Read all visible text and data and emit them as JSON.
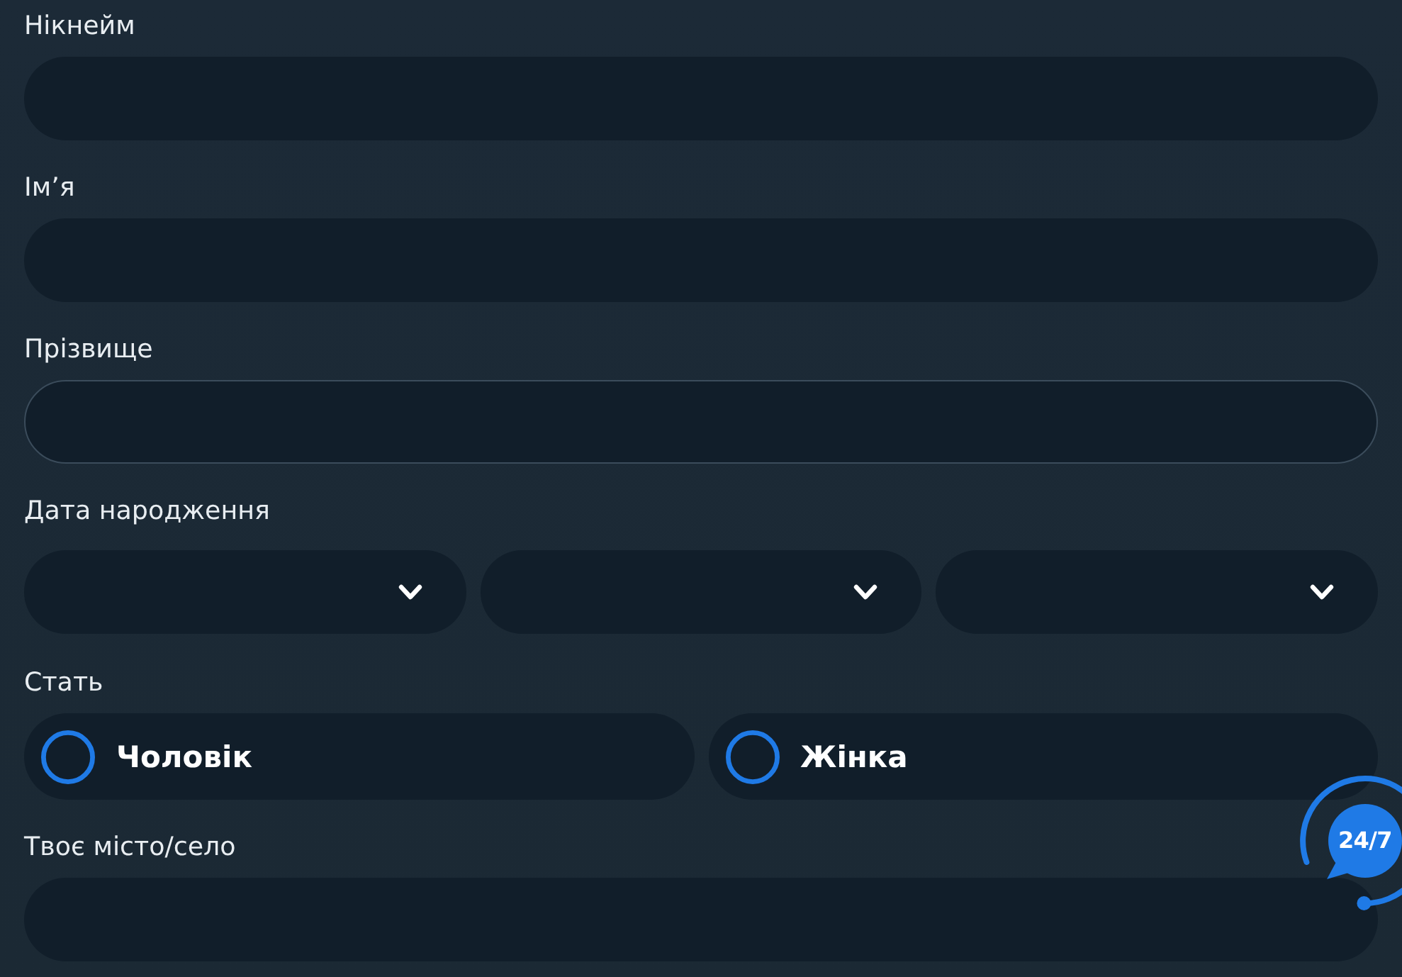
{
  "fields": [
    {
      "kind": "text",
      "label": "Нікнейм",
      "focused": false
    },
    {
      "kind": "text",
      "label": "Ім’я",
      "focused": false
    },
    {
      "kind": "text",
      "label": "Прізвище",
      "focused": true
    },
    {
      "kind": "date",
      "label": "Дата народження",
      "selects": [
        {
          "expanded": false
        },
        {
          "expanded": false
        },
        {
          "expanded": false
        }
      ]
    },
    {
      "kind": "radio",
      "label": "Стать",
      "options": [
        {
          "label": "Чоловік",
          "selected": false
        },
        {
          "label": "Жінка",
          "selected": false
        }
      ]
    },
    {
      "kind": "text",
      "label": "Твоє місто/село",
      "focused": false
    }
  ],
  "support_button": {
    "label": "24/7"
  }
}
